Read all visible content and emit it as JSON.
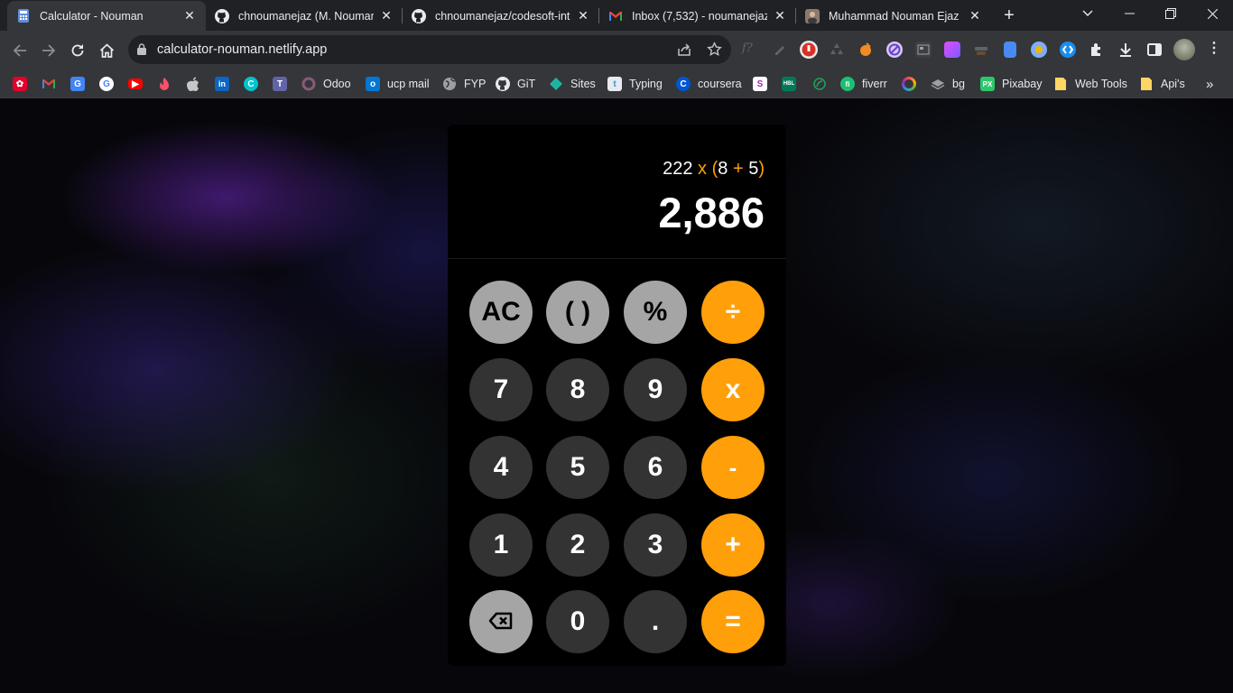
{
  "tabs": [
    {
      "title": "Calculator - Nouman",
      "favicon": "calculator-favicon",
      "active": true
    },
    {
      "title": "chnoumanejaz (M. Nouman E",
      "favicon": "github-icon",
      "active": false
    },
    {
      "title": "chnoumanejaz/codesoft-inte",
      "favicon": "github-icon",
      "active": false
    },
    {
      "title": "Inbox (7,532) - noumanejaz9",
      "favicon": "gmail-icon",
      "active": false
    },
    {
      "title": "Muhammad Nouman Ejaz",
      "favicon": "profile-photo-icon",
      "active": false
    }
  ],
  "address_bar": {
    "url": "calculator-nouman.netlify.app"
  },
  "bookmarks": [
    {
      "label": "",
      "icon": "huawei-icon",
      "color": "#e4002b"
    },
    {
      "label": "",
      "icon": "gmail-icon",
      "color": "#ea4335"
    },
    {
      "label": "",
      "icon": "translate-icon",
      "color": "#4285f4"
    },
    {
      "label": "",
      "icon": "google-icon",
      "color": "#ffffff"
    },
    {
      "label": "",
      "icon": "youtube-icon",
      "color": "#ff0000"
    },
    {
      "label": "",
      "icon": "tinder-icon",
      "color": "#fd5068"
    },
    {
      "label": "",
      "icon": "apple-icon",
      "color": "#c7c7c7"
    },
    {
      "label": "",
      "icon": "linkedin-icon",
      "color": "#0a66c2"
    },
    {
      "label": "",
      "icon": "canva-icon",
      "color": "#00c4cc"
    },
    {
      "label": "",
      "icon": "teams-icon",
      "color": "#6264a7"
    },
    {
      "label": "Odoo",
      "icon": "odoo-icon",
      "color": "#875a7b"
    },
    {
      "label": "ucp mail",
      "icon": "outlook-icon",
      "color": "#0078d4"
    },
    {
      "label": "FYP",
      "icon": "globe-icon",
      "color": "#9aa0a6"
    },
    {
      "label": "GiT",
      "icon": "github-icon",
      "color": "#ffffff"
    },
    {
      "label": "Sites",
      "icon": "sites-icon",
      "color": "#1fb3a3"
    },
    {
      "label": "Typing",
      "icon": "typing-icon",
      "color": "#2b9cd8"
    },
    {
      "label": "coursera",
      "icon": "coursera-icon",
      "color": "#0056d2"
    },
    {
      "label": "",
      "icon": "skillshare-icon",
      "color": "#9c27b0"
    },
    {
      "label": "",
      "icon": "hbl-icon",
      "color": "#00795a"
    },
    {
      "label": "",
      "icon": "leaf-icon",
      "color": "#1da35d"
    },
    {
      "label": "fiverr",
      "icon": "fiverr-icon",
      "color": "#1dbf73"
    },
    {
      "label": "",
      "icon": "color-wheel-icon",
      "color": "#ff8a00"
    },
    {
      "label": "bg",
      "icon": "layers-icon",
      "color": "#9aa0a6"
    },
    {
      "label": "Pixabay",
      "icon": "pixabay-icon",
      "color": "#2ec66d"
    },
    {
      "label": "Web Tools",
      "icon": "folder-icon",
      "color": "#fdd663"
    },
    {
      "label": "Api's",
      "icon": "folder-icon",
      "color": "#fdd663"
    }
  ],
  "calculator": {
    "expression": {
      "a": "222",
      "op1": "x",
      "lp": "(",
      "b": "8",
      "op2": "+",
      "c": "5",
      "rp": ")"
    },
    "result": "2,886",
    "keys": [
      {
        "label": "AC",
        "style": "light",
        "name": "all-clear-button"
      },
      {
        "label": "( )",
        "style": "light",
        "name": "parentheses-button"
      },
      {
        "label": "%",
        "style": "light",
        "name": "percent-button"
      },
      {
        "label": "÷",
        "style": "orange",
        "name": "divide-button"
      },
      {
        "label": "7",
        "style": "dark",
        "name": "digit-7-button"
      },
      {
        "label": "8",
        "style": "dark",
        "name": "digit-8-button"
      },
      {
        "label": "9",
        "style": "dark",
        "name": "digit-9-button"
      },
      {
        "label": "x",
        "style": "orange",
        "name": "multiply-button"
      },
      {
        "label": "4",
        "style": "dark",
        "name": "digit-4-button"
      },
      {
        "label": "5",
        "style": "dark",
        "name": "digit-5-button"
      },
      {
        "label": "6",
        "style": "dark",
        "name": "digit-6-button"
      },
      {
        "label": "-",
        "style": "orange",
        "name": "subtract-button"
      },
      {
        "label": "1",
        "style": "dark",
        "name": "digit-1-button"
      },
      {
        "label": "2",
        "style": "dark",
        "name": "digit-2-button"
      },
      {
        "label": "3",
        "style": "dark",
        "name": "digit-3-button"
      },
      {
        "label": "+",
        "style": "orange",
        "name": "add-button"
      },
      {
        "label": "",
        "style": "light",
        "name": "backspace-button",
        "icon": "backspace-icon"
      },
      {
        "label": "0",
        "style": "dark",
        "name": "digit-0-button"
      },
      {
        "label": ".",
        "style": "dark",
        "name": "decimal-button"
      },
      {
        "label": "=",
        "style": "orange",
        "name": "equals-button"
      }
    ]
  },
  "colors": {
    "accent": "#ff9f0a",
    "key_dark": "#333333",
    "key_light": "#a5a5a5"
  }
}
